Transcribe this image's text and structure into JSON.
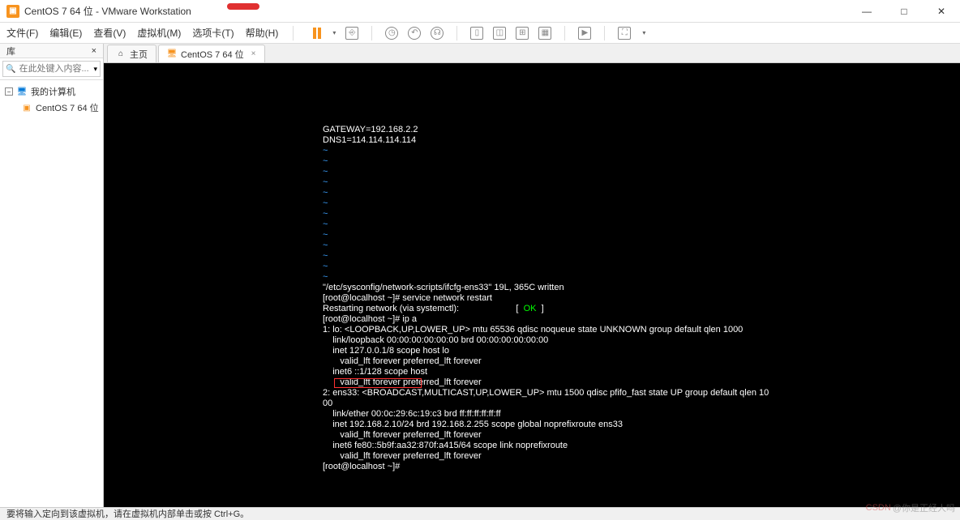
{
  "window": {
    "title": "CentOS 7 64 位 - VMware Workstation",
    "min": "—",
    "max": "□",
    "close": "✕"
  },
  "menu": {
    "file": "文件(F)",
    "edit": "编辑(E)",
    "view": "查看(V)",
    "vm": "虚拟机(M)",
    "tabs": "选项卡(T)",
    "help": "帮助(H)"
  },
  "sidebar": {
    "title": "库",
    "close": "×",
    "search_placeholder": "在此处键入内容...",
    "search_icon": "🔍",
    "dropdown": "▾",
    "toggle": "−",
    "root": "我的计算机",
    "child": "CentOS 7 64 位"
  },
  "tabs": {
    "home_icon": "⌂",
    "home": "主页",
    "vm_icon": "🖥",
    "vm": "CentOS 7 64 位",
    "x": "×"
  },
  "terminal": {
    "l01": "GATEWAY=192.168.2.2",
    "l02": "DNS1=114.114.114.114",
    "l03": "~",
    "l04": "~",
    "l05": "~",
    "l06": "~",
    "l07": "~",
    "l08": "~",
    "l09": "~",
    "l10": "~",
    "l11": "~",
    "l12": "~",
    "l13": "~",
    "l14": "~",
    "l15": "~",
    "l16": "\"/etc/sysconfig/network-scripts/ifcfg-ens33\" 19L, 365C written",
    "l17": "[root@localhost ~]# service network restart",
    "l18a": "Restarting network (via systemctl):",
    "l18b": "                       [  ",
    "l18c": "OK",
    "l18d": "  ]",
    "l19": "[root@localhost ~]# ip a",
    "l20": "1: lo: <LOOPBACK,UP,LOWER_UP> mtu 65536 qdisc noqueue state UNKNOWN group default qlen 1000",
    "l21": "    link/loopback 00:00:00:00:00:00 brd 00:00:00:00:00:00",
    "l22": "    inet 127.0.0.1/8 scope host lo",
    "l23": "       valid_lft forever preferred_lft forever",
    "l24": "    inet6 ::1/128 scope host",
    "l25": "       valid_lft forever preferred_lft forever",
    "l26": "2: ens33: <BROADCAST,MULTICAST,UP,LOWER_UP> mtu 1500 qdisc pfifo_fast state UP group default qlen 10",
    "l27": "00",
    "l28": "    link/ether 00:0c:29:6c:19:c3 brd ff:ff:ff:ff:ff:ff",
    "l29": "    inet 192.168.2.10/24 brd 192.168.2.255 scope global noprefixroute ens33",
    "l30": "       valid_lft forever preferred_lft forever",
    "l31": "    inet6 fe80::5b9f:aa32:870f:a415/64 scope link noprefixroute",
    "l32": "       valid_lft forever preferred_lft forever",
    "l33": "[root@localhost ~]# "
  },
  "status": "要将输入定向到该虚拟机，请在虚拟机内部单击或按 Ctrl+G。",
  "watermark": {
    "logo": "CSDN",
    "text": "@你是正经人吗"
  }
}
